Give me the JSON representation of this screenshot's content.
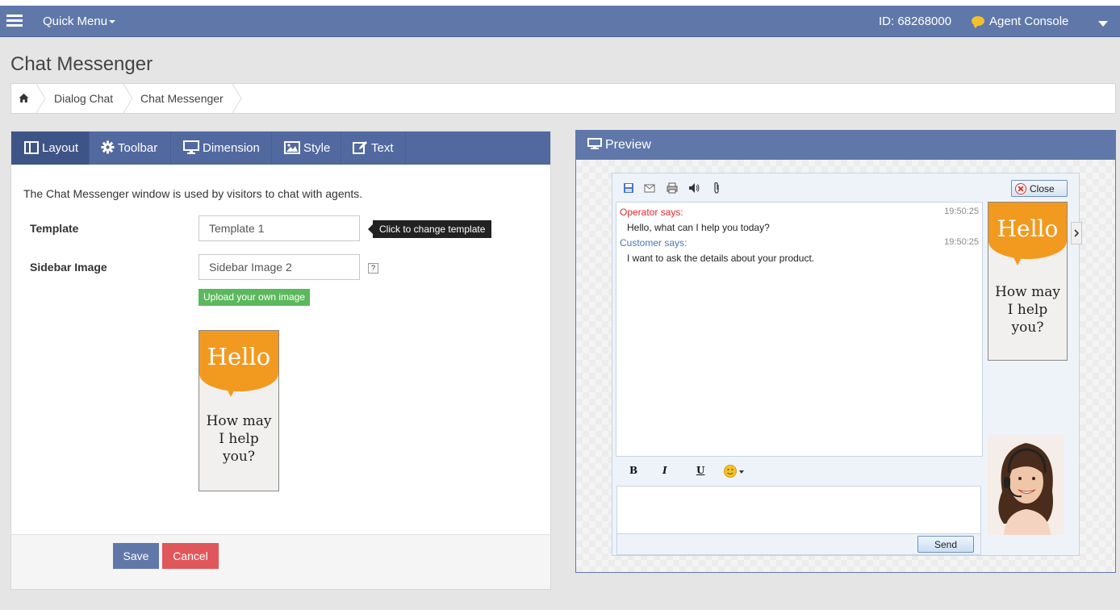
{
  "topbar": {
    "quick_menu": "Quick Menu",
    "id_label": "ID: 68268000",
    "agent_console": "Agent Console"
  },
  "page": {
    "title": "Chat Messenger"
  },
  "breadcrumb": [
    "Dialog Chat",
    "Chat Messenger"
  ],
  "tabs": [
    {
      "label": "Layout",
      "icon": "columns-icon",
      "active": true
    },
    {
      "label": "Toolbar",
      "icon": "gear-icon"
    },
    {
      "label": "Dimension",
      "icon": "monitor-icon"
    },
    {
      "label": "Style",
      "icon": "image-icon"
    },
    {
      "label": "Text",
      "icon": "edit-icon"
    }
  ],
  "form": {
    "description": "The Chat Messenger window is used by visitors to chat with agents.",
    "template_label": "Template",
    "template_value": "Template 1",
    "template_tooltip": "Click to change template",
    "sidebar_label": "Sidebar Image",
    "sidebar_value": "Sidebar Image 2",
    "help": "?",
    "upload_label": "Upload your own image",
    "save_label": "Save",
    "cancel_label": "Cancel"
  },
  "card": {
    "title": "Hello",
    "line1": "How may",
    "line2": "I help",
    "line3": "you?"
  },
  "preview": {
    "title": "Preview",
    "close_label": "Close",
    "send_label": "Send",
    "messages": [
      {
        "who": "Operator says:",
        "time": "19:50:25",
        "text": "Hello, what can I help you today?"
      },
      {
        "who": "Customer says:",
        "time": "19:50:25",
        "text": "I want to ask the details about your product."
      }
    ],
    "format": {
      "bold": "B",
      "italic": "I",
      "underline": "U"
    }
  },
  "colors": {
    "topbar": "#6078a9",
    "tab_bar": "#5269a0",
    "save": "#6078a9",
    "cancel": "#e0575b",
    "upload": "#5cb85c",
    "hello_orange": "#f29a1f",
    "operator": "#e0282d",
    "customer": "#4878b8"
  }
}
